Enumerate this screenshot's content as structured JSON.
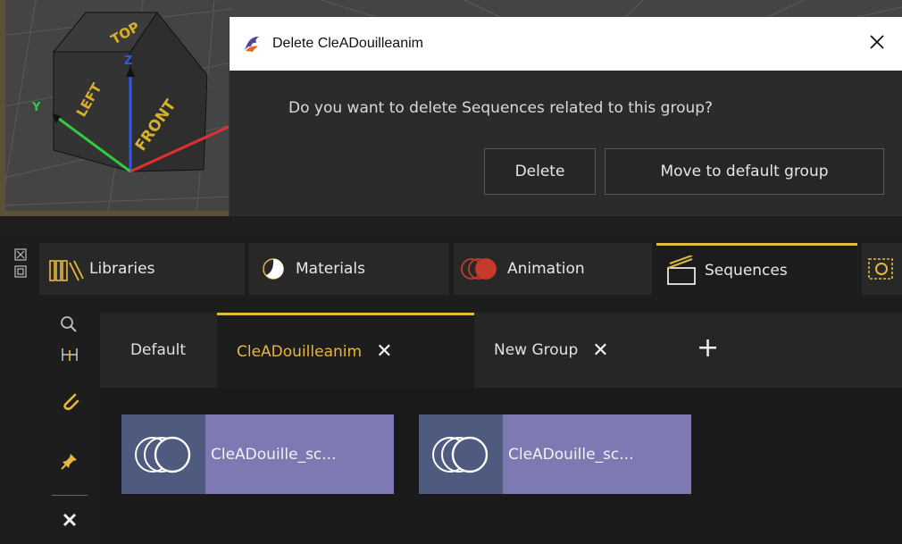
{
  "viewport": {
    "cube_faces": {
      "top": "TOP",
      "left": "LEFT",
      "front": "FRONT"
    },
    "axis_labels": {
      "z": "Z",
      "y": "Y"
    },
    "colors": {
      "x_axis": "#e03030",
      "y_axis": "#2ecc40",
      "z_axis": "#2f57e8",
      "cube_text": "#d8b12a"
    }
  },
  "dialog": {
    "title": "Delete CleADouilleanim",
    "message": "Do you want to delete Sequences related to this group?",
    "delete_label": "Delete",
    "move_label": "Move to default group",
    "close_icon": "×"
  },
  "tabs": [
    {
      "label": "Libraries",
      "icon": "libraries-icon"
    },
    {
      "label": "Materials",
      "icon": "materials-icon"
    },
    {
      "label": "Animation",
      "icon": "animation-icon"
    },
    {
      "label": "Sequences",
      "icon": "sequences-icon",
      "active": true
    }
  ],
  "groups": {
    "default_label": "Default",
    "active_label": "CleADouilleanim",
    "new_label": "New Group",
    "close_glyph": "✕",
    "add_glyph": "+"
  },
  "sequences": [
    {
      "name": "CleADouille_sc..."
    },
    {
      "name": "CleADouille_sc..."
    }
  ],
  "colors": {
    "accent": "#e5b93c",
    "card_thumb": "#4e5a7e",
    "card_label": "#7c79b3"
  }
}
